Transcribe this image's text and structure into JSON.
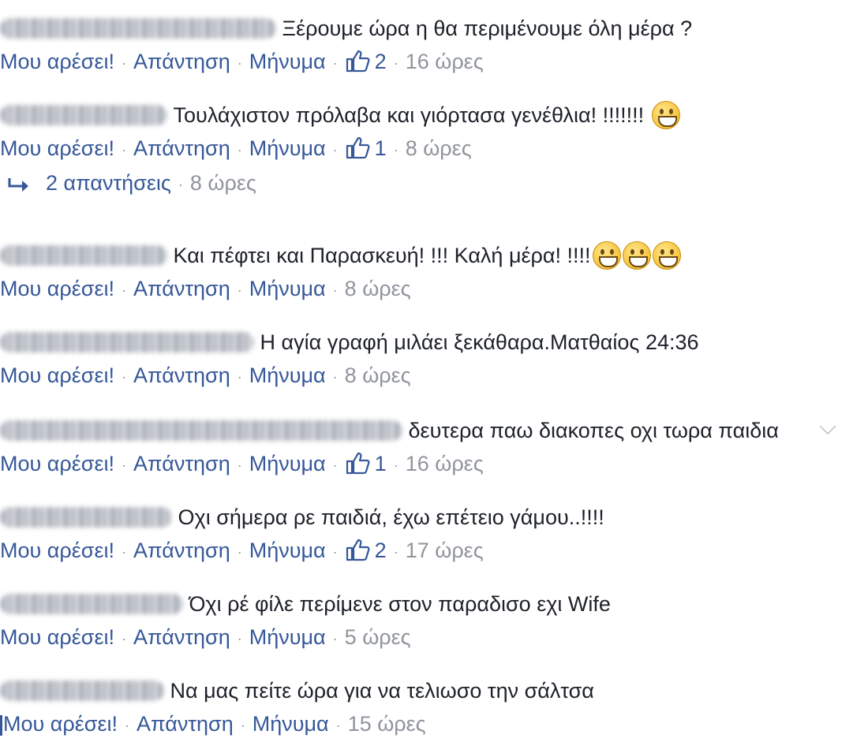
{
  "labels": {
    "like": "Μου αρέσει!",
    "reply": "Απάντηση",
    "message": "Μήνυμα",
    "separator": "·"
  },
  "comments": [
    {
      "author": "Βαγγέλης Παπαγεωργίου",
      "text": "Ξέρουμε ώρα η θα περιμένουμε όλη μέρα ?",
      "emojis": 0,
      "likes": "2",
      "time": "16 ώρες"
    },
    {
      "author": "Fany Antoniou",
      "text": "Τουλάχιστον πρόλαβα και γιόρτασα γενέθλια! !!!!!!!",
      "emojis": 1,
      "likes": "1",
      "time": "8 ώρες",
      "replies": {
        "label": "2 απαντήσεις",
        "time": "8 ώρες"
      }
    },
    {
      "author": "Fany Antoniou",
      "text": "Και πέφτει και Παρασκευή! !!! Καλή μέρα! !!!!",
      "emojis": 3,
      "likes": "",
      "time": "8 ώρες"
    },
    {
      "author": "Θανάσης Τσατσακίδης",
      "text": "Η αγία γραφή μιλάει ξεκάθαρα.Ματθαίος 24:36",
      "emojis": 0,
      "likes": "",
      "time": "8 ώρες"
    },
    {
      "author": "Νίκος Γεωργιακοπουλος Δευτερα",
      "text": "δευτερα παω διακοπες οχι τωρα παιδια",
      "emojis": 0,
      "likes": "1",
      "time": "16 ώρες",
      "chevron": true
    },
    {
      "author": "Vasiliki Pap",
      "text": "Οχι σήμερα ρε παιδιά, έχω επέτειο γάμου..!!!!",
      "emojis": 0,
      "likes": "2",
      "time": "17 ώρες"
    },
    {
      "author": "Stojan Georgiev",
      "text": "Όχι ρέ φίλε περίμενε στον παραδισο εχι Wife",
      "emojis": 0,
      "likes": "",
      "time": "5 ώρες"
    },
    {
      "author": "Dami Spalatov",
      "text": "Να μας πείτε ώρα για να τελιωσο την σάλτσα",
      "emojis": 0,
      "likes": "",
      "time": "15 ώρες",
      "pipe": true
    }
  ]
}
